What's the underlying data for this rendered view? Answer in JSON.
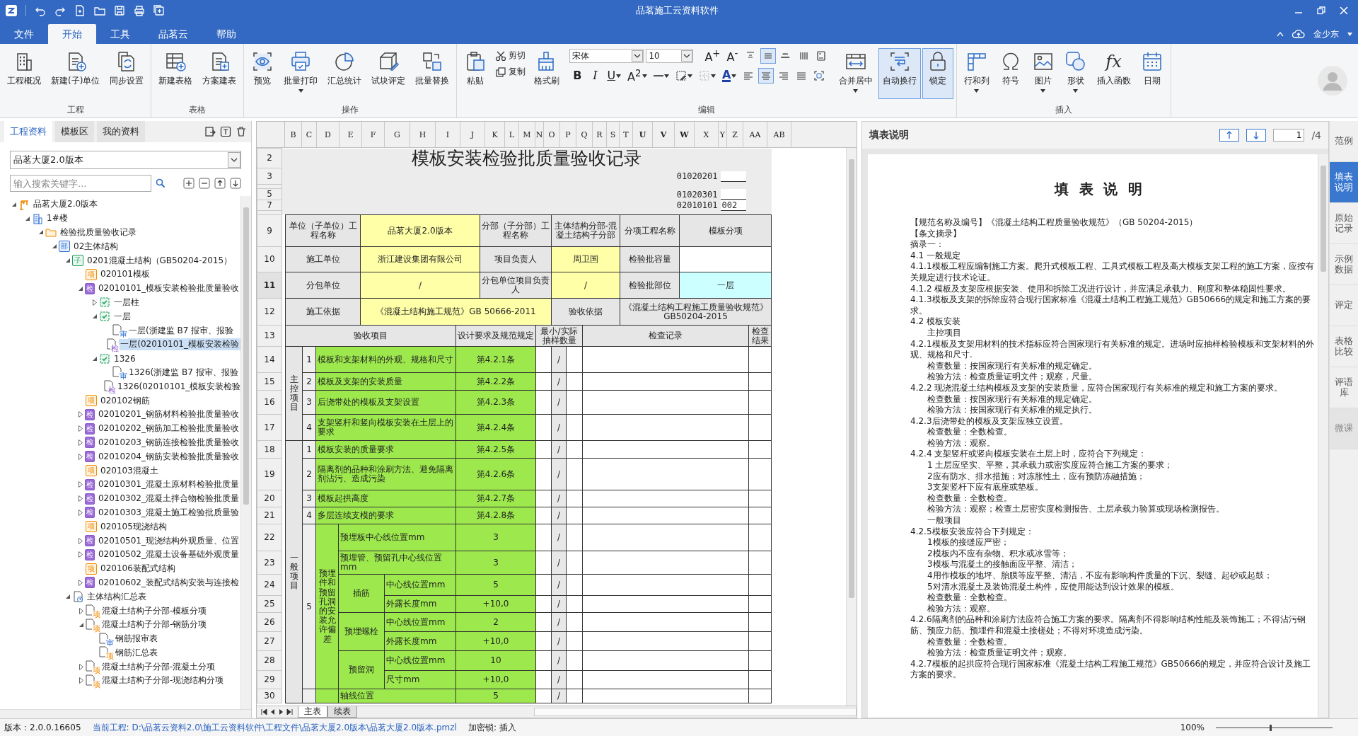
{
  "title_bar": {
    "title": "品茗施工云资料软件"
  },
  "menu": {
    "tabs": [
      {
        "label": "文件",
        "selected": false
      },
      {
        "label": "开始",
        "selected": true
      },
      {
        "label": "工具",
        "selected": false
      },
      {
        "label": "品茗云",
        "selected": false
      },
      {
        "label": "帮助",
        "selected": false
      }
    ],
    "user": "金少东"
  },
  "ribbon": {
    "groups": [
      {
        "label": "工程",
        "tools": [
          {
            "kind": "large",
            "label": "工程概况",
            "on": false
          },
          {
            "kind": "large",
            "label": "新建(子)单位",
            "on": false
          },
          {
            "kind": "large",
            "label": "同步设置",
            "on": false
          }
        ]
      },
      {
        "label": "表格",
        "tools": [
          {
            "kind": "large",
            "label": "新建表格",
            "on": false
          },
          {
            "kind": "large",
            "label": "方案建表",
            "on": false
          }
        ]
      },
      {
        "label": "操作",
        "tools": [
          {
            "kind": "large",
            "label": "预览",
            "on": false
          },
          {
            "kind": "large",
            "label": "批量打印",
            "on": false,
            "dropdown": true
          },
          {
            "kind": "large",
            "label": "汇总统计",
            "on": false
          },
          {
            "kind": "large",
            "label": "试块评定",
            "on": false
          },
          {
            "kind": "large",
            "label": "批量替换",
            "on": false
          }
        ]
      },
      {
        "label": "编辑",
        "tools": [
          {
            "kind": "large",
            "label": "粘贴",
            "on": false
          },
          {
            "kind": "stack",
            "tools": [
              {
                "kind": "cut",
                "label": "剪切"
              },
              {
                "kind": "copy",
                "label": "复制"
              }
            ]
          },
          {
            "kind": "large",
            "label": "格式刷",
            "on": false
          },
          {
            "kind": "format",
            "font": "宋体",
            "size": "10",
            "top_tools": [
              {
                "kind": "grow",
                "glyph": "A$^{+}$",
                "on": false
              },
              {
                "kind": "shrink",
                "glyph": "A$^{-}$",
                "on": false
              },
              {
                "kind": "align-top",
                "on": false
              },
              {
                "kind": "align-middle",
                "on": true
              },
              {
                "kind": "align-bottom",
                "on": false
              },
              {
                "kind": "vertical-text",
                "on": false
              },
              {
                "kind": "page",
                "on": false
              }
            ],
            "bottom_tools": [
              {
                "kind": "bold",
                "glyph": "B",
                "on": false
              },
              {
                "kind": "italic",
                "glyph": "I",
                "on": false
              },
              {
                "kind": "underline",
                "glyph": "U",
                "on": false,
                "dropdown": true
              },
              {
                "kind": "superscript",
                "glyph": "A$^{2}$",
                "on": false,
                "dropdown": true
              },
              {
                "kind": "line-style",
                "on": false,
                "dropdown": true
              },
              {
                "kind": "border",
                "on": false,
                "dropdown": true
              },
              {
                "kind": "grid",
                "on": false,
                "dropdown": true
              },
              {
                "kind": "font-color",
                "glyph": "A",
                "on": false,
                "dropdown": true
              },
              {
                "kind": "align-left",
                "on": false
              },
              {
                "kind": "align-center",
                "on": true
              },
              {
                "kind": "align-right",
                "on": false
              },
              {
                "kind": "justify",
                "on": false
              },
              {
                "kind": "fit",
                "on": false
              }
            ]
          },
          {
            "kind": "large",
            "label": "合并居中",
            "on": false,
            "dropdown": true
          },
          {
            "kind": "large",
            "label": "自动换行",
            "on": true
          },
          {
            "kind": "large",
            "label": "锁定",
            "on": true
          }
        ]
      },
      {
        "label": "插入",
        "tools": [
          {
            "kind": "large",
            "label": "行和列",
            "on": false,
            "dropdown": true
          },
          {
            "kind": "large",
            "label": "符号",
            "on": false
          },
          {
            "kind": "large",
            "label": "图片",
            "on": false,
            "dropdown": true
          },
          {
            "kind": "large",
            "label": "形状",
            "on": false,
            "dropdown": true
          },
          {
            "kind": "large",
            "glyph": "fx",
            "label": "插入函数",
            "on": false
          },
          {
            "kind": "large",
            "label": "日期",
            "on": false
          }
        ]
      }
    ]
  },
  "left_panel": {
    "tabs": [
      {
        "label": "工程资料",
        "selected": true
      },
      {
        "label": "模板区",
        "selected": false
      },
      {
        "label": "我的资料",
        "selected": false
      }
    ],
    "project": "品茗大厦2.0版本",
    "search": {
      "placeholder": "输入搜索关键字..."
    },
    "tree": [
      {
        "label": "品茗大厦2.0版本",
        "kind": "project",
        "expanded": true,
        "selected": false,
        "children": [
          {
            "label": "1#楼",
            "kind": "building",
            "expanded": true,
            "selected": false,
            "children": [
              {
                "label": "检验批质量验收记录",
                "kind": "folder",
                "expanded": true,
                "selected": false,
                "children": [
                  {
                    "label": "02主体结构",
                    "kind": "division",
                    "badge": "部",
                    "expanded": true,
                    "selected": false,
                    "children": [
                      {
                        "label": "0201混凝土结构（GB50204-2015）",
                        "kind": "subdivision",
                        "badge": "子",
                        "expanded": true,
                        "selected": false,
                        "children": [
                          {
                            "label": "020101模板",
                            "kind": "item",
                            "badge": "项",
                            "selected": false
                          },
                          {
                            "label": "02010101_模板安装检验批质量验收",
                            "kind": "batch",
                            "badge": "检",
                            "expanded": true,
                            "selected": false,
                            "children": [
                              {
                                "label": "一层柱",
                                "kind": "part",
                                "expanded": false,
                                "selected": false
                              },
                              {
                                "label": "一层",
                                "kind": "part",
                                "expanded": true,
                                "selected": false,
                                "children": [
                                  {
                                    "label": "一层(浙建监 B7 报审、报验",
                                    "kind": "review-doc",
                                    "badge": "审",
                                    "selected": false
                                  },
                                  {
                                    "label": "一层(02010101_模板安装检验",
                                    "kind": "batch-doc",
                                    "badge": "检",
                                    "selected": true
                                  }
                                ]
                              },
                              {
                                "label": "1326",
                                "kind": "part",
                                "expanded": true,
                                "selected": false,
                                "children": [
                                  {
                                    "label": "1326(浙建监 B7 报审、报验",
                                    "kind": "review-doc",
                                    "badge": "审",
                                    "selected": false
                                  },
                                  {
                                    "label": "1326(02010101_模板安装检验",
                                    "kind": "batch-doc",
                                    "badge": "检",
                                    "selected": false
                                  }
                                ]
                              }
                            ]
                          },
                          {
                            "label": "020102钢筋",
                            "kind": "item",
                            "badge": "项",
                            "selected": false
                          },
                          {
                            "label": "02010201_钢筋材料检验批质量验收",
                            "kind": "batch",
                            "badge": "检",
                            "expanded": false,
                            "selected": false
                          },
                          {
                            "label": "02010202_钢筋加工检验批质量验收",
                            "kind": "batch",
                            "badge": "检",
                            "expanded": false,
                            "selected": false
                          },
                          {
                            "label": "02010203_钢筋连接检验批质量验收",
                            "kind": "batch",
                            "badge": "检",
                            "expanded": false,
                            "selected": false
                          },
                          {
                            "label": "02010204_钢筋安装检验批质量验收",
                            "kind": "batch",
                            "badge": "检",
                            "expanded": false,
                            "selected": false
                          },
                          {
                            "label": "020103混凝土",
                            "kind": "item",
                            "badge": "项",
                            "selected": false
                          },
                          {
                            "label": "02010301_混凝土原材料检验批质量",
                            "kind": "batch",
                            "badge": "检",
                            "expanded": false,
                            "selected": false
                          },
                          {
                            "label": "02010302_混凝土拌合物检验批质量",
                            "kind": "batch",
                            "badge": "检",
                            "expanded": false,
                            "selected": false
                          },
                          {
                            "label": "02010303_混凝土施工检验批质量验",
                            "kind": "batch",
                            "badge": "检",
                            "expanded": false,
                            "selected": false
                          },
                          {
                            "label": "020105现浇结构",
                            "kind": "item",
                            "badge": "项",
                            "selected": false
                          },
                          {
                            "label": "02010501_现浇结构外观质量、位置",
                            "kind": "batch",
                            "badge": "检",
                            "expanded": false,
                            "selected": false
                          },
                          {
                            "label": "02010502_混凝土设备基础外观质量",
                            "kind": "batch",
                            "badge": "检",
                            "expanded": false,
                            "selected": false
                          },
                          {
                            "label": "020106装配式结构",
                            "kind": "item",
                            "badge": "项",
                            "selected": false
                          },
                          {
                            "label": "02010602_装配式结构安装与连接检",
                            "kind": "batch",
                            "badge": "检",
                            "expanded": false,
                            "selected": false
                          }
                        ]
                      },
                      {
                        "label": "主体结构汇总表",
                        "kind": "summary",
                        "expanded": true,
                        "selected": false,
                        "children": [
                          {
                            "label": "混凝土结构子分部-模板分项",
                            "kind": "summary-doc",
                            "badge": "项",
                            "expanded": false,
                            "selected": false
                          },
                          {
                            "label": "混凝土结构子分部-钢筋分项",
                            "kind": "summary-doc",
                            "badge": "项",
                            "expanded": true,
                            "selected": false,
                            "children": [
                              {
                                "label": "钢筋报审表",
                                "kind": "review-doc",
                                "badge": "审",
                                "selected": false
                              },
                              {
                                "label": "钢筋汇总表",
                                "kind": "summary-doc",
                                "badge": "项",
                                "selected": false
                              }
                            ]
                          },
                          {
                            "label": "混凝土结构子分部-混凝土分项",
                            "kind": "summary-doc",
                            "badge": "项",
                            "expanded": false,
                            "selected": false
                          },
                          {
                            "label": "混凝土结构子分部-现浇结构分项",
                            "kind": "summary-doc",
                            "badge": "项",
                            "expanded": false,
                            "selected": false
                          }
                        ]
                      }
                    ]
                  }
                ]
              }
            ]
          }
        ]
      }
    ]
  },
  "sheet": {
    "columns": [
      "B",
      "C",
      "D",
      "E",
      "F",
      "G",
      "H",
      "I",
      "J",
      "K",
      "L",
      "M",
      "N",
      "O",
      "P",
      "Q",
      "R",
      "S",
      "T",
      "U",
      "V",
      "W",
      "X",
      "Y",
      "Z",
      "AA",
      "AB"
    ],
    "title": "模板安装检验批质量验收记录",
    "top_rows": [
      {
        "number": "2",
        "kind": "title",
        "selected": false
      },
      {
        "number": "3",
        "kind": "code",
        "code": "01020201",
        "selected": false
      },
      {
        "kind": "gap",
        "selected": false
      },
      {
        "number": "5",
        "kind": "code",
        "code": "01020301",
        "selected": false
      },
      {
        "number": "7",
        "kind": "code",
        "code": "02010101",
        "value": "002",
        "selected": false
      },
      {
        "kind": "gap",
        "selected": false
      }
    ],
    "form_rows": [
      {
        "number": "9",
        "selected": false,
        "fields": [
          {
            "kind": "label",
            "text": "单位（子单位）工程名称"
          },
          {
            "kind": "value",
            "text": "品茗大厦2.0版本"
          },
          {
            "kind": "label",
            "text": "分部（子分部）工程名称"
          },
          {
            "kind": "label",
            "text": "主体结构分部-混凝土结构子分部"
          },
          {
            "kind": "label",
            "text": "分项工程名称"
          },
          {
            "kind": "label",
            "text": "模板分项"
          }
        ]
      },
      {
        "number": "10",
        "selected": false,
        "fields": [
          {
            "kind": "label",
            "text": "施工单位"
          },
          {
            "kind": "value",
            "text": "浙江建设集团有限公司"
          },
          {
            "kind": "label",
            "text": "项目负责人"
          },
          {
            "kind": "value",
            "text": "周卫国"
          },
          {
            "kind": "label",
            "text": "检验批容量"
          },
          {
            "kind": "blank"
          }
        ]
      },
      {
        "number": "11",
        "selected": true,
        "fields": [
          {
            "kind": "label",
            "text": "分包单位"
          },
          {
            "kind": "value",
            "text": "/"
          },
          {
            "kind": "label",
            "text": "分包单位项目负责人"
          },
          {
            "kind": "value",
            "text": "/"
          },
          {
            "kind": "label",
            "text": "检验批部位"
          },
          {
            "kind": "highlight",
            "text": "一层"
          }
        ]
      },
      {
        "number": "12",
        "selected": false,
        "fields": [
          {
            "kind": "label",
            "text": "施工依据"
          },
          {
            "kind": "value",
            "text": "《混凝土结构施工规范》GB 50666-2011"
          },
          {
            "kind": "label",
            "text": "验收依据"
          },
          {
            "kind": "label",
            "text": "《混凝土结构工程施工质量验收规范》GB50204-2015"
          }
        ]
      },
      {
        "number": "13",
        "selected": false,
        "fields": [
          {
            "kind": "label",
            "text": "验收项目"
          },
          {
            "kind": "label",
            "text": "设计要求及规范规定"
          },
          {
            "kind": "label",
            "text": "最小/实际抽样数量"
          },
          {
            "kind": "label",
            "text": "检查记录"
          },
          {
            "kind": "label",
            "text": "检查结果"
          }
        ]
      },
      {
        "number": "14",
        "selected": false,
        "sample": "/",
        "fields": [
          {
            "kind": "side",
            "text": "主控项目"
          },
          {
            "kind": "number",
            "text": "1"
          },
          {
            "kind": "item",
            "text": "模板和支架材料的外观、规格和尺寸"
          },
          {
            "kind": "spec",
            "text": "第4.2.1条"
          }
        ]
      },
      {
        "number": "15",
        "selected": false,
        "sample": "/",
        "fields": [
          {
            "kind": "number",
            "text": "2"
          },
          {
            "kind": "item",
            "text": "模板及支架的安装质量"
          },
          {
            "kind": "spec",
            "text": "第4.2.2条"
          }
        ]
      },
      {
        "number": "16",
        "selected": false,
        "sample": "/",
        "fields": [
          {
            "kind": "number",
            "text": "3"
          },
          {
            "kind": "item",
            "text": "后浇带处的模板及支架设置"
          },
          {
            "kind": "spec",
            "text": "第4.2.3条"
          }
        ]
      },
      {
        "number": "17",
        "selected": false,
        "sample": "/",
        "fields": [
          {
            "kind": "number",
            "text": "4"
          },
          {
            "kind": "item",
            "text": "支架竖杆和竖向模板安装在土层上的要求"
          },
          {
            "kind": "spec",
            "text": "第4.2.4条"
          }
        ]
      },
      {
        "number": "18",
        "selected": false,
        "sample": "/",
        "fields": [
          {
            "kind": "side",
            "text": "一般项目"
          },
          {
            "kind": "number",
            "text": "1"
          },
          {
            "kind": "item",
            "text": "模板安装的质量要求"
          },
          {
            "kind": "spec",
            "text": "第4.2.5条"
          }
        ]
      },
      {
        "number": "19",
        "selected": false,
        "sample": "/",
        "fields": [
          {
            "kind": "number",
            "text": "2"
          },
          {
            "kind": "item",
            "text": "隔离剂的品种和涂刷方法、避免隔离剂沾污、造成污染"
          },
          {
            "kind": "spec",
            "text": "第4.2.6条"
          }
        ]
      },
      {
        "number": "20",
        "selected": false,
        "sample": "/",
        "fields": [
          {
            "kind": "number",
            "text": "3"
          },
          {
            "kind": "item",
            "text": "模板起拱高度"
          },
          {
            "kind": "spec",
            "text": "第4.2.7条"
          }
        ]
      },
      {
        "number": "21",
        "selected": false,
        "sample": "/",
        "fields": [
          {
            "kind": "number",
            "text": "4"
          },
          {
            "kind": "item",
            "text": "多层连续支模的要求"
          },
          {
            "kind": "spec",
            "text": "第4.2.8条"
          }
        ]
      },
      {
        "number": "22",
        "selected": false,
        "sample": "/",
        "fields": [
          {
            "kind": "number",
            "text": "5"
          },
          {
            "kind": "group",
            "text": "预埋件和预留孔洞的安装允许偏差"
          },
          {
            "kind": "item",
            "text": "预埋板中心线位置mm"
          },
          {
            "kind": "spec",
            "text": "3"
          }
        ]
      },
      {
        "number": "23",
        "selected": false,
        "sample": "/",
        "fields": [
          {
            "kind": "item",
            "text": "预埋管、预留孔中心线位置mm"
          },
          {
            "kind": "spec",
            "text": "3"
          }
        ]
      },
      {
        "number": "24",
        "selected": false,
        "sample": "/",
        "fields": [
          {
            "kind": "spec",
            "text": "插筋"
          },
          {
            "kind": "item",
            "text": "中心线位置mm"
          },
          {
            "kind": "spec",
            "text": "5"
          }
        ]
      },
      {
        "number": "25",
        "selected": false,
        "sample": "/",
        "fields": [
          {
            "kind": "item",
            "text": "外露长度mm"
          },
          {
            "kind": "spec",
            "text": "+10,0"
          }
        ]
      },
      {
        "number": "26",
        "selected": false,
        "sample": "/",
        "fields": [
          {
            "kind": "spec",
            "text": "预埋螺栓"
          },
          {
            "kind": "item",
            "text": "中心线位置mm"
          },
          {
            "kind": "spec",
            "text": "2"
          }
        ]
      },
      {
        "number": "27",
        "selected": false,
        "sample": "/",
        "fields": [
          {
            "kind": "item",
            "text": "外露长度mm"
          },
          {
            "kind": "spec",
            "text": "+10,0"
          }
        ]
      },
      {
        "number": "28",
        "selected": false,
        "sample": "/",
        "fields": [
          {
            "kind": "spec",
            "text": "预留洞"
          },
          {
            "kind": "item",
            "text": "中心线位置mm"
          },
          {
            "kind": "spec",
            "text": "10"
          }
        ]
      },
      {
        "number": "29",
        "selected": false,
        "sample": "/",
        "fields": [
          {
            "kind": "item",
            "text": "尺寸mm"
          },
          {
            "kind": "spec",
            "text": "+10,0"
          }
        ]
      },
      {
        "number": "30",
        "selected": false,
        "sample": "/",
        "fields": [
          {
            "kind": "number"
          },
          {
            "kind": "group"
          },
          {
            "kind": "item",
            "text": "轴线位置"
          },
          {
            "kind": "spec",
            "text": "5"
          }
        ]
      }
    ],
    "tabs": [
      {
        "label": "主表",
        "selected": true
      },
      {
        "label": "续表",
        "selected": false
      }
    ]
  },
  "right_panel": {
    "title": "填表说明",
    "page": "1",
    "pages": "/4",
    "doc_title": "填 表 说 明",
    "lines": [
      {
        "text": "【规范名称及编号】《混凝土结构工程质量验收规范》（GB 50204-2015）",
        "indent": false
      },
      {
        "text": "【条文摘录】",
        "indent": false
      },
      {
        "text": "摘录一：",
        "indent": false
      },
      {
        "text": "4.1  一般规定",
        "indent": false
      },
      {
        "text": "4.1.1模板工程应编制施工方案。爬升式模板工程、工具式模板工程及高大模板支架工程的施工方案，应按有关规定进行技术论证。",
        "indent": false
      },
      {
        "text": "4.1.2  模板及支架应根据安装、使用和拆除工况进行设计，并应满足承载力、刚度和整体稳固性要求。",
        "indent": false
      },
      {
        "text": "4.1.3模板及支架的拆除应符合现行国家标准《混凝土结构工程施工规范》GB50666的规定和施工方案的要求。",
        "indent": false
      },
      {
        "text": "4.2  模板安装",
        "indent": false
      },
      {
        "text": "主控项目",
        "indent": true
      },
      {
        "text": "4.2.1模板及支架用材料的技术指标应符合国家现行有关标准的规定。进场时应抽样检验模板和支架材料的外观、规格和尺寸.",
        "indent": false
      },
      {
        "text": "检查数量：按国家现行有关标准的规定确定。",
        "indent": true
      },
      {
        "text": "检验方法：检查质量证明文件；观察，尺量。",
        "indent": true
      },
      {
        "text": "4.2.2  现浇混凝土结构模板及支架的安装质量，应符合国家现行有关标准的规定和施工方案的要求。",
        "indent": false
      },
      {
        "text": "检查数量：按国家现行有关标准的规定确定。",
        "indent": true
      },
      {
        "text": "检验方法：按国家现行有关标准的规定执行。",
        "indent": true
      },
      {
        "text": "4.2.3后浇带处的模板及支架应独立设置。",
        "indent": false
      },
      {
        "text": "检查数量：全数检查。",
        "indent": true
      },
      {
        "text": "检验方法：观察。",
        "indent": true
      },
      {
        "text": "4.2.4  支架竖杆或竖向模板安装在土层上时，应符合下列规定：",
        "indent": false
      },
      {
        "text": "1  土层应坚实、平整，其承载力或密实度应符合施工方案的要求；",
        "indent": true
      },
      {
        "text": "2应有防水、排水措施；对冻胀性土，应有预防冻融措施；",
        "indent": true
      },
      {
        "text": "3支架竖杆下应有底座或垫板。",
        "indent": true
      },
      {
        "text": "检查数量：全数检查。",
        "indent": true
      },
      {
        "text": "检验方法：观察；检查土层密实度检测报告、土层承载力验算或现场检测报告。",
        "indent": true
      },
      {
        "text": "一般项目",
        "indent": true
      },
      {
        "text": "4.2.5模板安装应符合下列规定：",
        "indent": false
      },
      {
        "text": "1模板的接缝应严密；",
        "indent": true
      },
      {
        "text": "2模板内不应有杂物、积水或冰雪等；",
        "indent": true
      },
      {
        "text": "3模板与混凝土的接触面应平整、清洁；",
        "indent": true
      },
      {
        "text": "4用作模板的地坪、胎膜等应平整、清洁，不应有影响构件质量的下沉、裂缝、起砂或起鼓；",
        "indent": true
      },
      {
        "text": "5对清水混凝土及装饰混凝土构件，应使用能达到设计效果的模板。",
        "indent": true
      },
      {
        "text": "检查数量：全数检查。",
        "indent": true
      },
      {
        "text": "检验方法：观察。",
        "indent": true
      },
      {
        "text": "4.2.6隔离剂的品种和涂刷方法应符合施工方案的要求。隔离剂不得影响结构性能及装饰施工；不得沾污钢筋、预应力筋、预埋件和混凝土接槎处；不得对环境造成污染。",
        "indent": false
      },
      {
        "text": "检查数量：全数检查。",
        "indent": true
      },
      {
        "text": "检验方法：检查质量证明文件；观察。",
        "indent": true
      },
      {
        "text": "4.2.7模板的起拱应符合现行国家标准《混凝土结构工程施工规范》GB50666的规定，并应符合设计及施工方案的要求。",
        "indent": false
      }
    ],
    "side_tabs": [
      {
        "label": "范例",
        "selected": false,
        "disabled": false
      },
      {
        "label": "填表说明",
        "selected": true,
        "disabled": false
      },
      {
        "label": "原始记录",
        "selected": false,
        "disabled": false
      },
      {
        "label": "示例数据",
        "selected": false,
        "disabled": false
      },
      {
        "label": "评定",
        "selected": false,
        "disabled": false
      },
      {
        "label": "表格比较",
        "selected": false,
        "disabled": false
      },
      {
        "label": "评语库",
        "selected": false,
        "disabled": false
      },
      {
        "label": "微课",
        "selected": false,
        "disabled": true
      }
    ]
  },
  "status_bar": {
    "version": "版本：2.0.0.16605",
    "path": "当前工程: D:\\品茗云资料2.0\\施工云资料软件\\工程文件\\品茗大厦2.0版本\\品茗大厦2.0版本.pmzl",
    "lock": "加密锁: 插入",
    "zoom": "100%",
    "zoom_slider": {
      "level": 0.46
    }
  }
}
